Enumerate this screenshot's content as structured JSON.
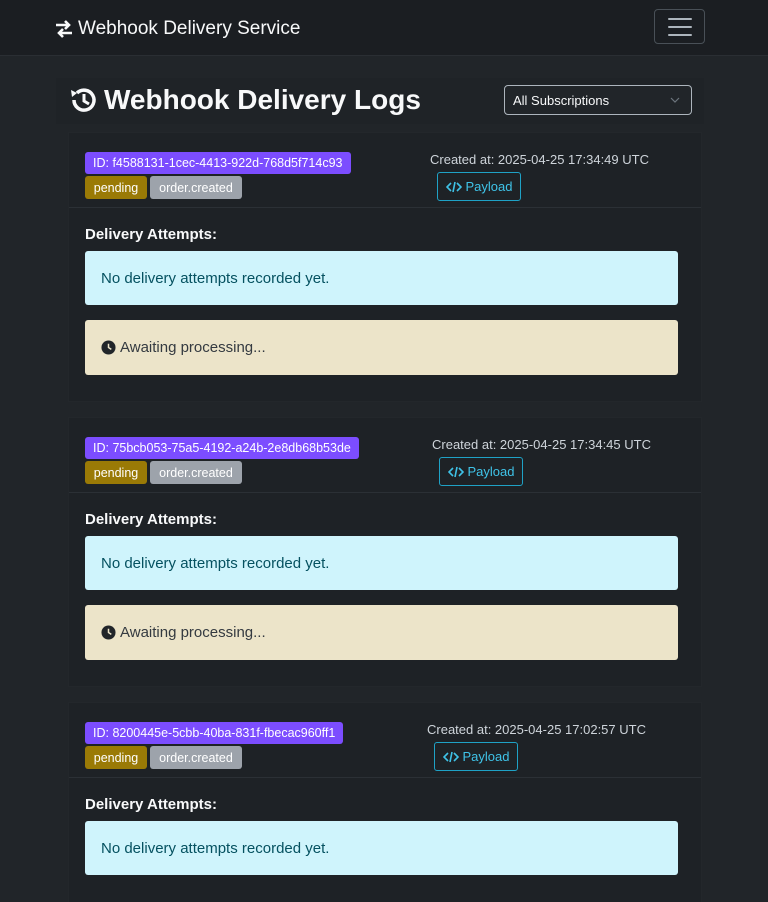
{
  "app": {
    "brand": "Webhook Delivery Service",
    "brand_icon": "exchange-arrows-icon",
    "menu_icon": "hamburger-menu-icon"
  },
  "page": {
    "title": "Webhook Delivery Logs",
    "title_icon": "history-icon",
    "filter": {
      "selected": "All Subscriptions",
      "icon": "chevron-down-icon"
    }
  },
  "labels": {
    "payload": "Payload",
    "attempts": "Delivery Attempts:",
    "no_attempts": "No delivery attempts recorded yet.",
    "awaiting": "Awaiting processing..."
  },
  "deliveries": [
    {
      "id_text": "ID: f4588131-1cec-4413-922d-768d5f714c93",
      "status": "pending",
      "event": "order.created",
      "created": "Created at: 2025-04-25 17:34:49 UTC"
    },
    {
      "id_text": "ID: 75bcb053-75a5-4192-a24b-2e8db68b53de",
      "status": "pending",
      "event": "order.created",
      "created": "Created at: 2025-04-25 17:34:45 UTC"
    },
    {
      "id_text": "ID: 8200445e-5cbb-40ba-831f-fbecac960ff1",
      "status": "pending",
      "event": "order.created",
      "created": "Created at: 2025-04-25 17:02:57 UTC"
    }
  ],
  "colors": {
    "background": "#212529",
    "id_badge": "#7c4dff",
    "pending_badge": "#9a7a06",
    "event_badge": "#9da3ab",
    "info_bg": "#cff4fc",
    "info_text": "#055160",
    "warning_bg": "#ece4c9",
    "payload_accent": "#3fc3e8"
  }
}
